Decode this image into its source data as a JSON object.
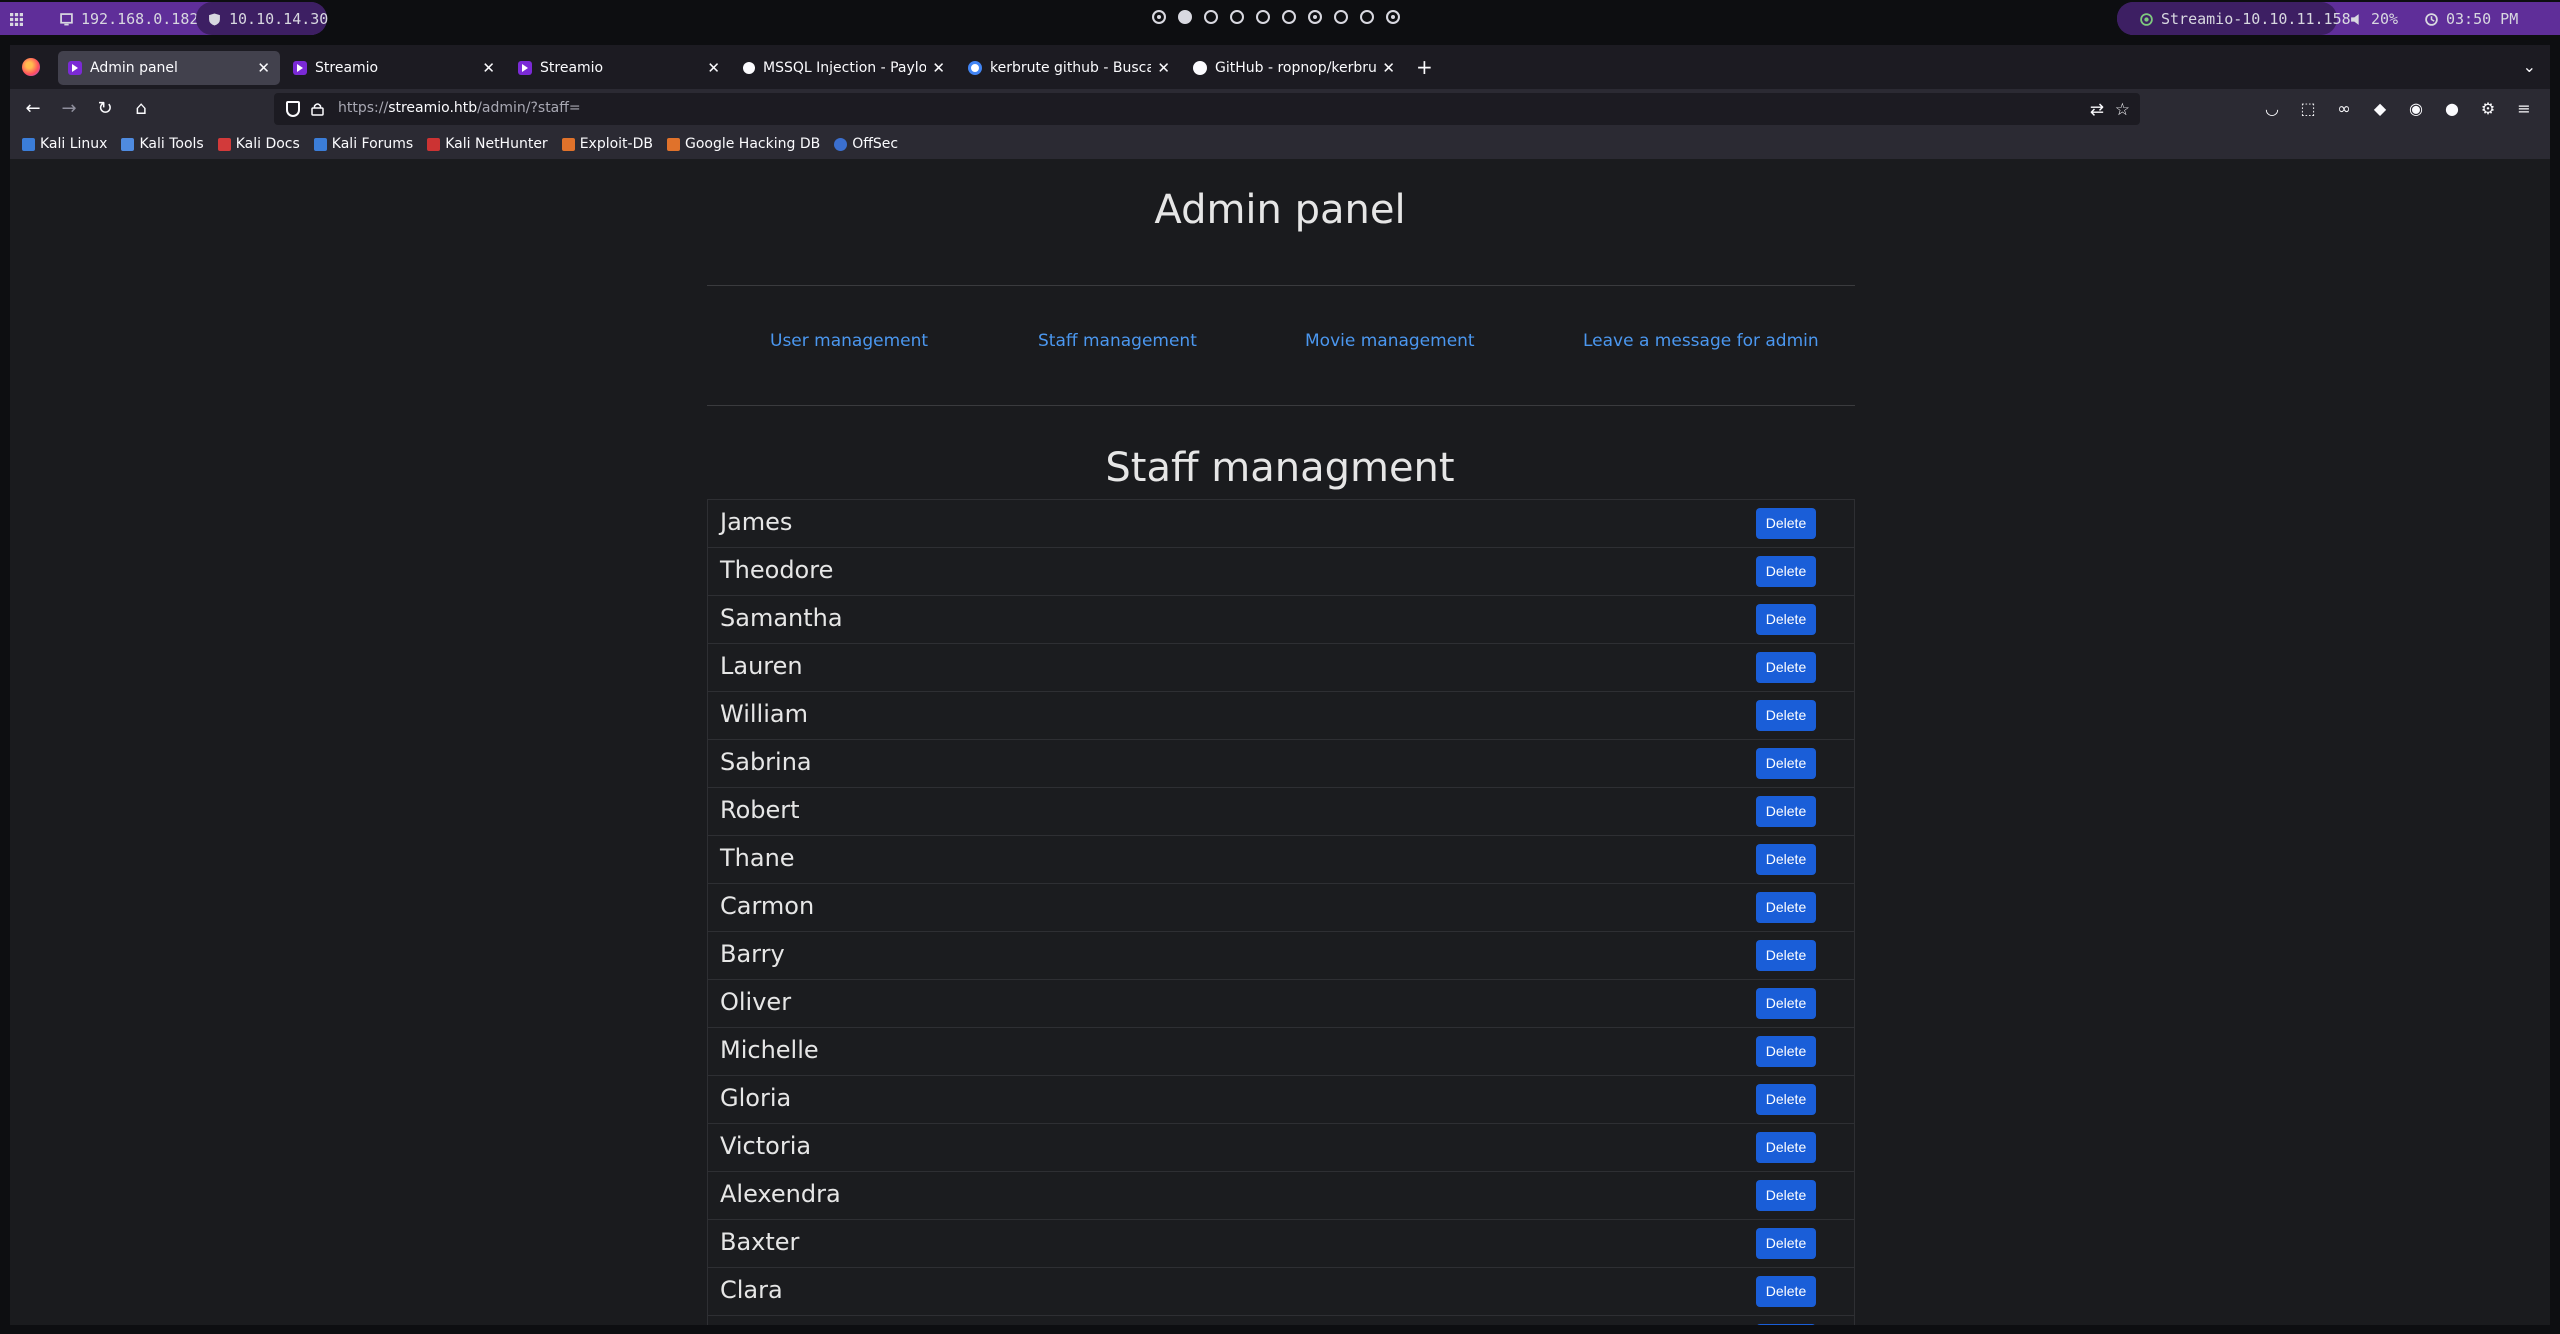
{
  "system_bar": {
    "local_ip": "192.168.0.182",
    "vpn_ip": "10.10.14.30",
    "target": "Streamio-10.10.11.158",
    "volume": "20%",
    "clock": "03:50 PM"
  },
  "browser": {
    "tabs": [
      {
        "label": "Admin panel",
        "favicon": "streamio-icon",
        "active": true
      },
      {
        "label": "Streamio",
        "favicon": "streamio-icon",
        "active": false
      },
      {
        "label": "Streamio",
        "favicon": "streamio-icon",
        "active": false
      },
      {
        "label": "MSSQL Injection - Payload",
        "favicon": "payload-icon",
        "active": false
      },
      {
        "label": "kerbrute github - Buscar c",
        "favicon": "google-icon",
        "active": false
      },
      {
        "label": "GitHub - ropnop/kerbrute",
        "favicon": "github-icon",
        "active": false
      }
    ],
    "url": {
      "protocol": "https://",
      "host": "streamio.htb",
      "path": "/admin/?staff="
    },
    "bookmarks": [
      "Kali Linux",
      "Kali Tools",
      "Kali Docs",
      "Kali Forums",
      "Kali NetHunter",
      "Exploit-DB",
      "Google Hacking DB",
      "OffSec"
    ]
  },
  "page": {
    "title": "Admin panel",
    "menu": {
      "user": "User management",
      "staff": "Staff management",
      "movie": "Movie management",
      "message": "Leave a message for admin"
    },
    "section_title": "Staff managment",
    "delete_label": "Delete",
    "staff": [
      "James",
      "Theodore",
      "Samantha",
      "Lauren",
      "William",
      "Sabrina",
      "Robert",
      "Thane",
      "Carmon",
      "Barry",
      "Oliver",
      "Michelle",
      "Gloria",
      "Victoria",
      "Alexendra",
      "Baxter",
      "Clara",
      ""
    ]
  },
  "colors": {
    "accent": "#5f2e99",
    "link": "#4b97ef",
    "delete_button": "#1a5ed8"
  }
}
